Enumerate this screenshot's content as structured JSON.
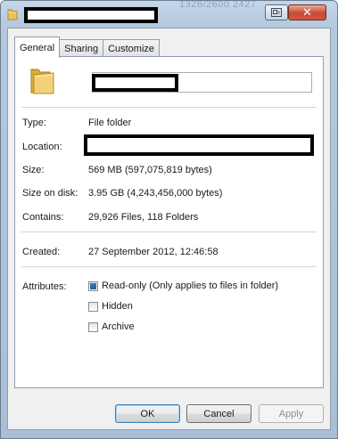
{
  "titlebar": {
    "ghost_text": "1326/2600 2427",
    "close_glyph": "✕"
  },
  "tabs": [
    {
      "label": "General",
      "active": true
    },
    {
      "label": "Sharing",
      "active": false
    },
    {
      "label": "Customize",
      "active": false
    }
  ],
  "general": {
    "type_label": "Type:",
    "type_value": "File folder",
    "location_label": "Location:",
    "size_label": "Size:",
    "size_value": "569 MB (597,075,819 bytes)",
    "size_on_disk_label": "Size on disk:",
    "size_on_disk_value": "3.95 GB (4,243,456,000 bytes)",
    "contains_label": "Contains:",
    "contains_value": "29,926 Files, 118 Folders",
    "created_label": "Created:",
    "created_value": "27 September 2012, 12:46:58",
    "attributes_label": "Attributes:",
    "attributes": [
      {
        "label": "Read-only (Only applies to files in folder)",
        "state": "indeterminate"
      },
      {
        "label": "Hidden",
        "state": "unchecked"
      },
      {
        "label": "Archive",
        "state": "unchecked"
      }
    ]
  },
  "buttons": {
    "ok": "OK",
    "cancel": "Cancel",
    "apply": "Apply"
  },
  "icons": {
    "title": "folder-icon",
    "big": "folder-icon",
    "help": "help-icon",
    "close": "close-icon"
  },
  "colors": {
    "accent": "#3c7fb1",
    "folder": "#e8c35a",
    "close_button": "#c74a32"
  }
}
